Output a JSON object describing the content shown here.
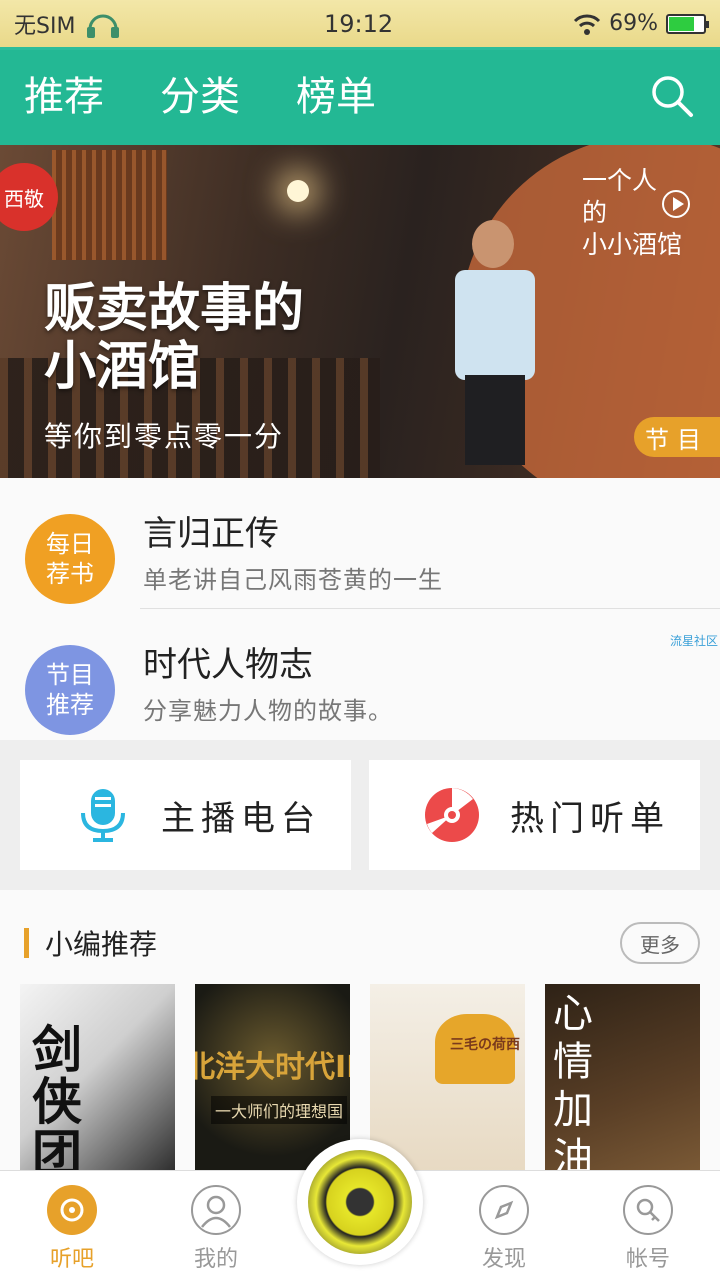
{
  "status_bar": {
    "sim": "无SIM",
    "time": "19:12",
    "battery": "69%",
    "battery_level": 0.69
  },
  "top_nav": {
    "tabs": [
      {
        "label": "推荐",
        "active": true
      },
      {
        "label": "分类",
        "active": false
      },
      {
        "label": "榜单",
        "active": false
      }
    ]
  },
  "banner": {
    "lantern": "西敬",
    "title_line1": "贩卖故事的",
    "title_line2": "小酒馆",
    "subtitle": "等你到零点零一分",
    "side_line1": "一个人",
    "side_line2": "的",
    "side_line3": "小小酒馆",
    "tag": "节目"
  },
  "features": [
    {
      "badge_line1": "每日",
      "badge_line2": "荐书",
      "badge_color": "#f0a023",
      "title": "言归正传",
      "desc": "单老讲自己风雨苍黄的一生"
    },
    {
      "badge_line1": "节目",
      "badge_line2": "推荐",
      "badge_color": "#7e95e2",
      "title": "时代人物志",
      "desc": "分享魅力人物的故事。"
    }
  ],
  "watermark": "流星社区",
  "quick_buttons": [
    {
      "label": "主播电台",
      "icon": "microphone-icon",
      "color": "#2bb6e0"
    },
    {
      "label": "热门听单",
      "icon": "disc-icon",
      "color": "#ec4a4a"
    }
  ],
  "recommend": {
    "title": "小编推荐",
    "more": "更多",
    "covers": [
      {
        "text": "剑侠团"
      },
      {
        "text": "北洋大时代II",
        "text2": "一大师们的理想国"
      },
      {
        "text": "三毛の荷西"
      },
      {
        "text": "心情加油站"
      }
    ]
  },
  "bottom_nav": {
    "items": [
      {
        "label": "听吧",
        "icon": "record-icon",
        "active": true
      },
      {
        "label": "我的",
        "icon": "user-icon",
        "active": false
      },
      {
        "label": "发现",
        "icon": "compass-icon",
        "active": false
      },
      {
        "label": "帐号",
        "icon": "account-key-icon",
        "active": false
      }
    ]
  },
  "colors": {
    "accent_green": "#23b894",
    "accent_orange": "#e7a12a"
  }
}
